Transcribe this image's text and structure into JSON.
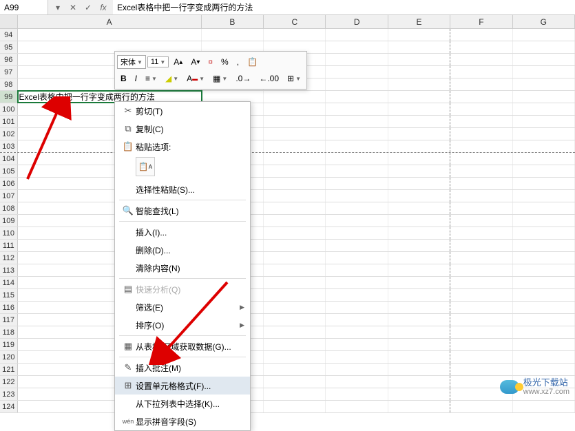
{
  "nameBox": "A99",
  "formulaValue": "Excel表格中把一行字变成两行的方法",
  "columns": [
    "A",
    "B",
    "C",
    "D",
    "E",
    "F",
    "G"
  ],
  "rows": [
    94,
    95,
    96,
    97,
    98,
    99,
    100,
    101,
    102,
    103,
    104,
    105,
    106,
    107,
    108,
    109,
    110,
    111,
    112,
    113,
    114,
    115,
    116,
    117,
    118,
    119,
    120,
    121,
    122,
    123,
    124
  ],
  "selectedRow": 99,
  "cellA99": "Excel表格中把一行字变成两行的方法",
  "miniToolbar": {
    "font": "宋体",
    "size": "11",
    "btns": {
      "increaseFont": "A↑",
      "decreaseFont": "A↓",
      "comma": ",",
      "percent": "%",
      "bold": "B",
      "italic": "I"
    }
  },
  "contextMenu": {
    "cut": "剪切(T)",
    "copy": "复制(C)",
    "pasteOptionsHeader": "粘贴选项:",
    "pasteSpecial": "选择性粘贴(S)...",
    "smartLookup": "智能查找(L)",
    "insert": "插入(I)...",
    "delete": "删除(D)...",
    "clearContents": "清除内容(N)",
    "quickAnalysis": "快速分析(Q)",
    "filter": "筛选(E)",
    "sort": "排序(O)",
    "getFromTable": "从表格/区域获取数据(G)...",
    "insertComment": "插入批注(M)",
    "formatCells": "设置单元格格式(F)...",
    "pickFromList": "从下拉列表中选择(K)...",
    "showPhonetic": "显示拼音字段(S)"
  },
  "watermark": {
    "name": "极光下载站",
    "url": "www.xz7.com"
  }
}
